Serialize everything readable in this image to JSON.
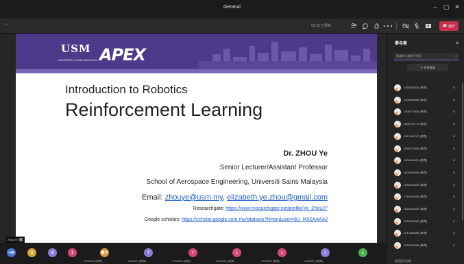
{
  "window": {
    "title": "General"
  },
  "toolbar": {
    "more": "···",
    "recording": "59:28 已录制",
    "leave_label": "离开"
  },
  "slide": {
    "logo_usm": "USM",
    "logo_usm_sub": "UNIVERSITI SAINS MALAYSIA",
    "logo_apex": "APEX",
    "title_line1": "Introduction to Robotics",
    "title_line2": "Reinforcement Learning",
    "author": "Dr. ZHOU Ye",
    "position": "Senior Lecturer/Assistant Professor",
    "school": "School of Aerospace Engineering, Universiti Sains Malaysia",
    "email_label": "Email: ",
    "email1": "zhouye@usm.my",
    "email_sep": ", ",
    "email2": "elizabeth.ye.zhou@gmail.com",
    "researchgate_label": "Researchgate: ",
    "researchgate_url": "https://www.researchgate.net/profile/Ye_Zhou27",
    "scholar_label": "Google scholars: ",
    "scholar_url": "https://scholar.google.com.my/citations?hl=en&user=8U_l4X0AAAAJ"
  },
  "presenter": {
    "name": "Zhou Ye"
  },
  "bottom_strip": [
    {
      "initial": "+46",
      "color": "#4a78d6",
      "name": ""
    },
    {
      "initial": "D",
      "color": "#d9a43a",
      "name": ""
    },
    {
      "initial": "8",
      "color": "#8d7bd9",
      "name": ""
    },
    {
      "initial": "1",
      "color": "#d4477a",
      "name": ""
    },
    {
      "initial": "藏于",
      "color": "#d6963a",
      "name": "1500000 (来宾)"
    },
    {
      "initial": "7",
      "color": "#8d7bd9",
      "name": "1600000 (来宾)"
    },
    {
      "initial": "7",
      "color": "#d4477a",
      "name": "1700000 (来宾)"
    },
    {
      "initial": "1",
      "color": "#d4477a",
      "name": "1800000 (来宾)"
    },
    {
      "initial": "1",
      "color": "#d4477a",
      "name": "1900000 (来宾)"
    },
    {
      "initial": "1",
      "color": "#8d7bd9",
      "name": "1500000 (来宾)"
    },
    {
      "initial": "L",
      "color": "#4caf50",
      "name": ""
    }
  ],
  "panel": {
    "title": "参与者",
    "search_placeholder": "邀请他人或拨打号码",
    "share_label": "共享邀请",
    "footer": "首页显示名称",
    "participants": [
      "1363505332 (来宾)",
      "1402560858 (来宾)",
      "1506779835 (来宾)",
      "1509275771 (来宾)",
      "1511400747 (来宾)",
      "1565379290 (来宾)",
      "1500662820 (来宾)",
      "1609296606 (来宾)",
      "1696530515 (来宾)",
      "1766424936 (来宾)",
      "1825533452 (来宾)",
      "1902865464 (来宾)",
      "1917866889 (来宾)",
      "1922589386 (来宾)"
    ]
  }
}
